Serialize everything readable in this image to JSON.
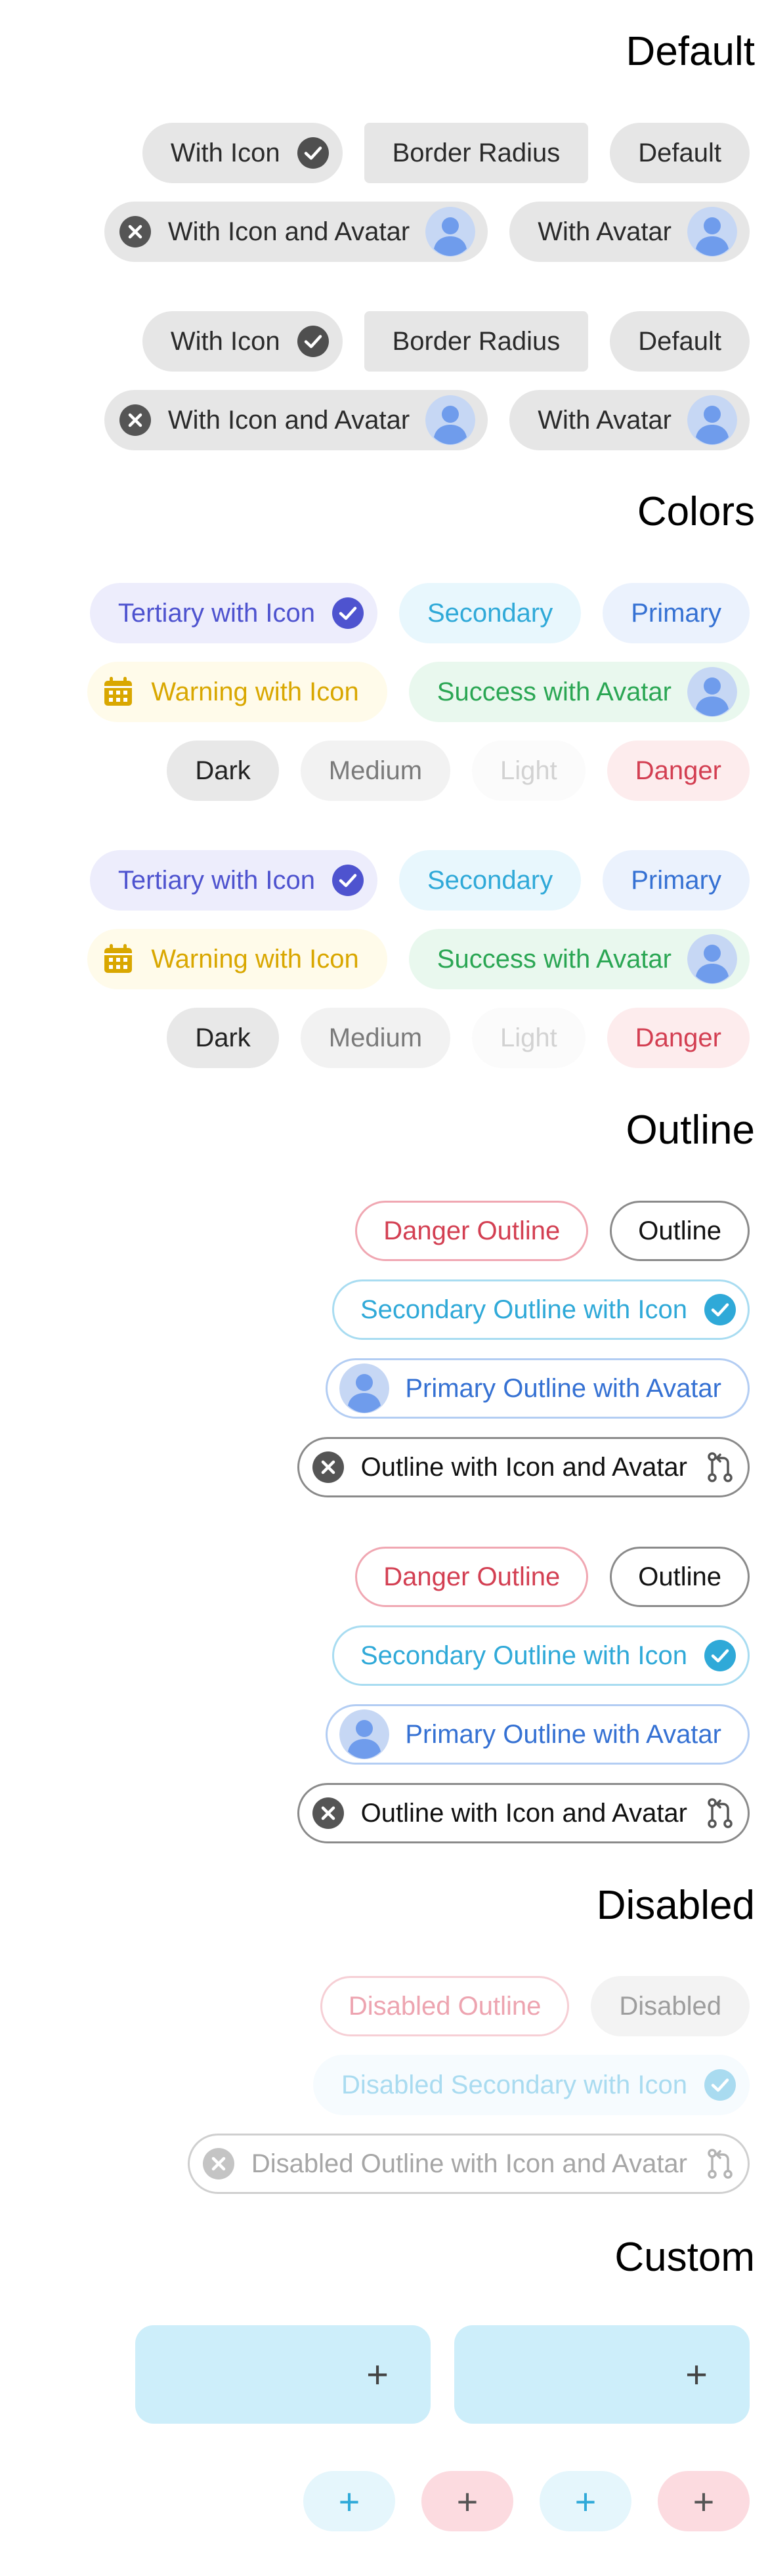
{
  "sections": {
    "default": {
      "title": "Default"
    },
    "colors": {
      "title": "Colors"
    },
    "outline": {
      "title": "Outline"
    },
    "disabled": {
      "title": "Disabled"
    },
    "custom": {
      "title": "Custom"
    }
  },
  "default_chips": {
    "with_icon": "With Icon",
    "border_radius": "Border Radius",
    "default": "Default",
    "with_icon_and_avatar": "With Icon and Avatar",
    "with_avatar": "With Avatar"
  },
  "color_chips": {
    "tertiary_with_icon": "Tertiary with Icon",
    "secondary": "Secondary",
    "primary": "Primary",
    "warning_with_icon": "Warning with Icon",
    "success_with_avatar": "Success with Avatar",
    "dark": "Dark",
    "medium": "Medium",
    "light": "Light",
    "danger": "Danger"
  },
  "outline_chips": {
    "danger_outline": "Danger Outline",
    "outline": "Outline",
    "secondary_outline_with_icon": "Secondary Outline with Icon",
    "primary_outline_with_avatar": "Primary Outline with Avatar",
    "outline_with_icon_and_avatar": "Outline with Icon and Avatar"
  },
  "disabled_chips": {
    "disabled_outline": "Disabled Outline",
    "disabled": "Disabled",
    "disabled_secondary_with_icon": "Disabled Secondary with Icon",
    "disabled_outline_with_icon_and_avatar": "Disabled Outline with Icon and Avatar"
  },
  "custom_chips": {
    "add_glyph": "+"
  },
  "icons": {
    "checkmark": "checkmark-circle-icon",
    "close": "close-circle-icon",
    "calendar": "calendar-icon",
    "avatar": "avatar-icon",
    "git_pull_request": "git-pull-request-icon",
    "add": "add-icon"
  },
  "colors": {
    "tertiary": "#4e53cf",
    "secondary": "#2fa9d8",
    "primary": "#3571d3",
    "warning": "#d9a700",
    "success": "#2aa653",
    "danger": "#d33f52",
    "dark": "#222222",
    "medium": "#7a7a7a",
    "light": "#d2d2d2"
  }
}
